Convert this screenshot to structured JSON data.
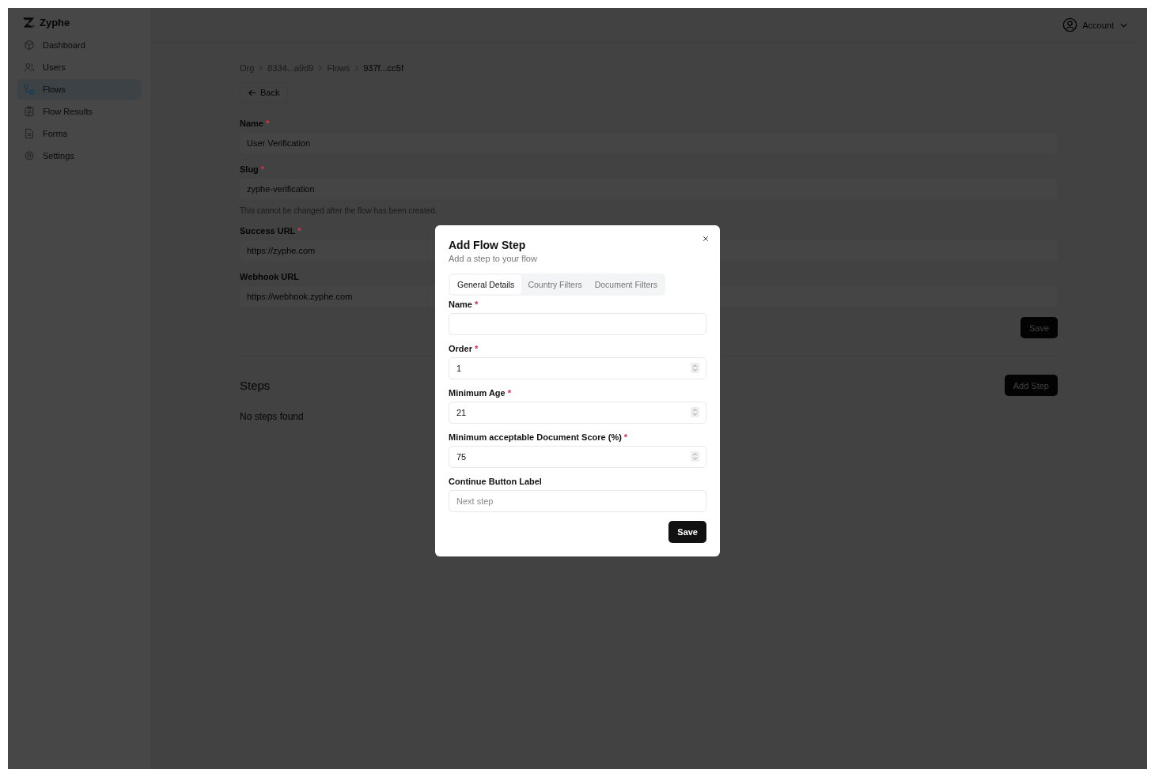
{
  "brand": {
    "name": "Zyphe"
  },
  "sidebar": {
    "items": [
      {
        "label": "Dashboard",
        "selected": false
      },
      {
        "label": "Users",
        "selected": false
      },
      {
        "label": "Flows",
        "selected": true
      },
      {
        "label": "Flow Results",
        "selected": false
      },
      {
        "label": "Forms",
        "selected": false
      },
      {
        "label": "Settings",
        "selected": false
      }
    ]
  },
  "account": {
    "label": "Account"
  },
  "breadcrumb": [
    {
      "label": "Org",
      "current": false
    },
    {
      "label": "8334...a9d9",
      "current": false
    },
    {
      "label": "Flows",
      "current": false
    },
    {
      "label": "937f...cc5f",
      "current": true
    }
  ],
  "back_button": {
    "label": "Back"
  },
  "form": {
    "fields": [
      {
        "label": "Name",
        "required_mark": "*",
        "value": "User Verification"
      },
      {
        "label": "Slug",
        "required_mark": "*",
        "value": "zyphe-verification",
        "hint": "This cannot be changed after the flow has been created."
      },
      {
        "label": "Success URL",
        "required_mark": "*",
        "value": "https://zyphe.com"
      },
      {
        "label": "Webhook URL",
        "value": "https://webhook.zyphe.com"
      }
    ],
    "save_button": "Save"
  },
  "steps": {
    "title": "Steps",
    "add_button": "Add Step",
    "empty": "No steps found"
  },
  "dialog": {
    "title": "Add Flow Step",
    "subtitle": "Add a step to your flow",
    "tabs": [
      {
        "label": "General Details",
        "selected": true
      },
      {
        "label": "Country Filters",
        "selected": false
      },
      {
        "label": "Document Filters",
        "selected": false
      }
    ],
    "fields": [
      {
        "label": "Name",
        "required_mark": "*",
        "kind": "text"
      },
      {
        "label": "Order",
        "required_mark": "*",
        "kind": "number",
        "value": "1"
      },
      {
        "label": "Minimum Age",
        "required_mark": "*",
        "kind": "number",
        "value": "21"
      },
      {
        "label": "Minimum acceptable Document Score (%)",
        "required_mark": "*",
        "kind": "number",
        "value": "75"
      },
      {
        "label": "Continue Button Label",
        "kind": "text",
        "placeholder": "Next step"
      }
    ],
    "save_button": "Save"
  }
}
